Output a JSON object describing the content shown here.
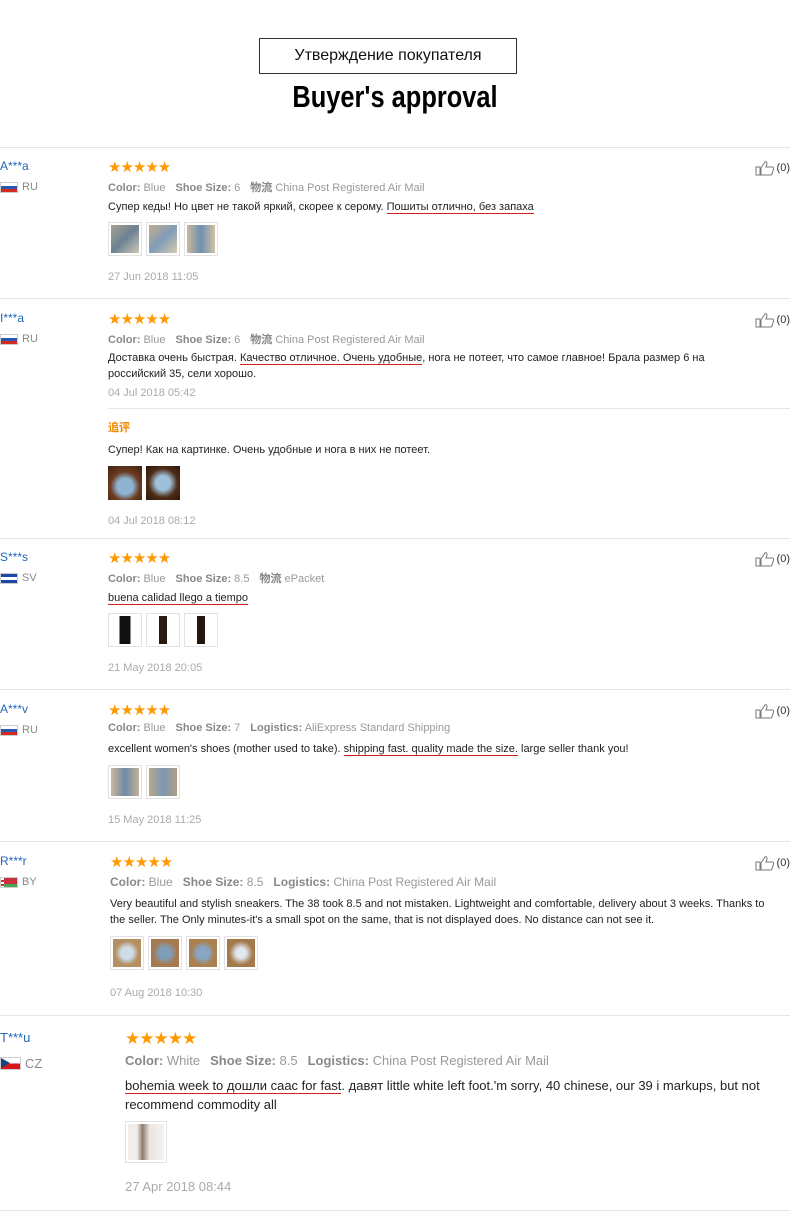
{
  "header": {
    "title_ru": "Утверждение покупателя",
    "title_en": "Buyer's approval"
  },
  "colors": {
    "star": "#ff9900",
    "user": "#2266bb",
    "underline": "#d21f1f",
    "followup": "#f08a00"
  },
  "reviews": [
    {
      "user": "A***a",
      "country": "RU",
      "stars": "★★★★★",
      "color_label": "Color:",
      "color": "Blue",
      "size_label": "Shoe Size:",
      "size": "6",
      "ship_label": "物流",
      "ship": "China Post Registered Air Mail",
      "text_a": "Супер кеды! Но цвет не такой яркий, скорее к серому. ",
      "text_u": "Пошиты отлично, без запаха",
      "date": "27 Jun 2018 11:05",
      "helpful": "(0)"
    },
    {
      "user": "I***a",
      "country": "RU",
      "stars": "★★★★★",
      "color_label": "Color:",
      "color": "Blue",
      "size_label": "Shoe Size:",
      "size": "6",
      "ship_label": "物流",
      "ship": "China Post Registered Air Mail",
      "text_a": "Доставка очень быстрая. ",
      "text_u": "Качество отличное. Очень удобные",
      "text_b": ", нога не потеет, что самое главное! Брала размер 6 на российский 35, сели хорошо.",
      "date": "04 Jul 2018 05:42",
      "followup_label": "追评",
      "followup_text": "Супер! Как на картинке. Очень удобные и нога в них не потеет.",
      "followup_date": "04 Jul 2018 08:12",
      "helpful": "(0)"
    },
    {
      "user": "S***s",
      "country": "SV",
      "stars": "★★★★★",
      "color_label": "Color:",
      "color": "Blue",
      "size_label": "Shoe Size:",
      "size": "8.5",
      "ship_label": "物流",
      "ship": "ePacket",
      "text_u": "buena calidad llego a tiempo",
      "date": "21 May 2018 20:05",
      "helpful": "(0)"
    },
    {
      "user": "A***v",
      "country": "RU",
      "stars": "★★★★★",
      "color_label": "Color:",
      "color": "Blue",
      "size_label": "Shoe Size:",
      "size": "7",
      "ship_label": "Logistics:",
      "ship": "AliExpress Standard Shipping",
      "text_a": "excellent women's shoes (mother used to take). ",
      "text_u": "shipping fast. quality made the size.",
      "text_b": " large seller thank you!",
      "date": "15 May 2018 11:25",
      "helpful": "(0)"
    },
    {
      "user": "R***r",
      "country": "BY",
      "stars": "★★★★★",
      "color_label": "Color:",
      "color": "Blue",
      "size_label": "Shoe Size:",
      "size": "8.5",
      "ship_label": "Logistics:",
      "ship": "China Post Registered Air Mail",
      "text_a": "Very beautiful and stylish sneakers. The 38 took 8.5 and not mistaken. Lightweight and comfortable, delivery about 3 weeks. Thanks to the seller. The Only minutes-it's a small spot on the same, that is not displayed does. No distance can not see it.",
      "date": "07 Aug 2018 10:30",
      "helpful": "(0)"
    },
    {
      "user": "T***u",
      "country": "CZ",
      "stars": "★★★★★",
      "color_label": "Color:",
      "color": "White",
      "size_label": "Shoe Size:",
      "size": "8.5",
      "ship_label": "Logistics:",
      "ship": "China Post Registered Air Mail",
      "text_u": "bohemia week to дошли саас for fast",
      "text_b": ". давят little white left foot.'m sorry, 40 chinese, our 39 i markups, but not recommend commodity all",
      "date": "27 Apr 2018 08:44"
    }
  ]
}
